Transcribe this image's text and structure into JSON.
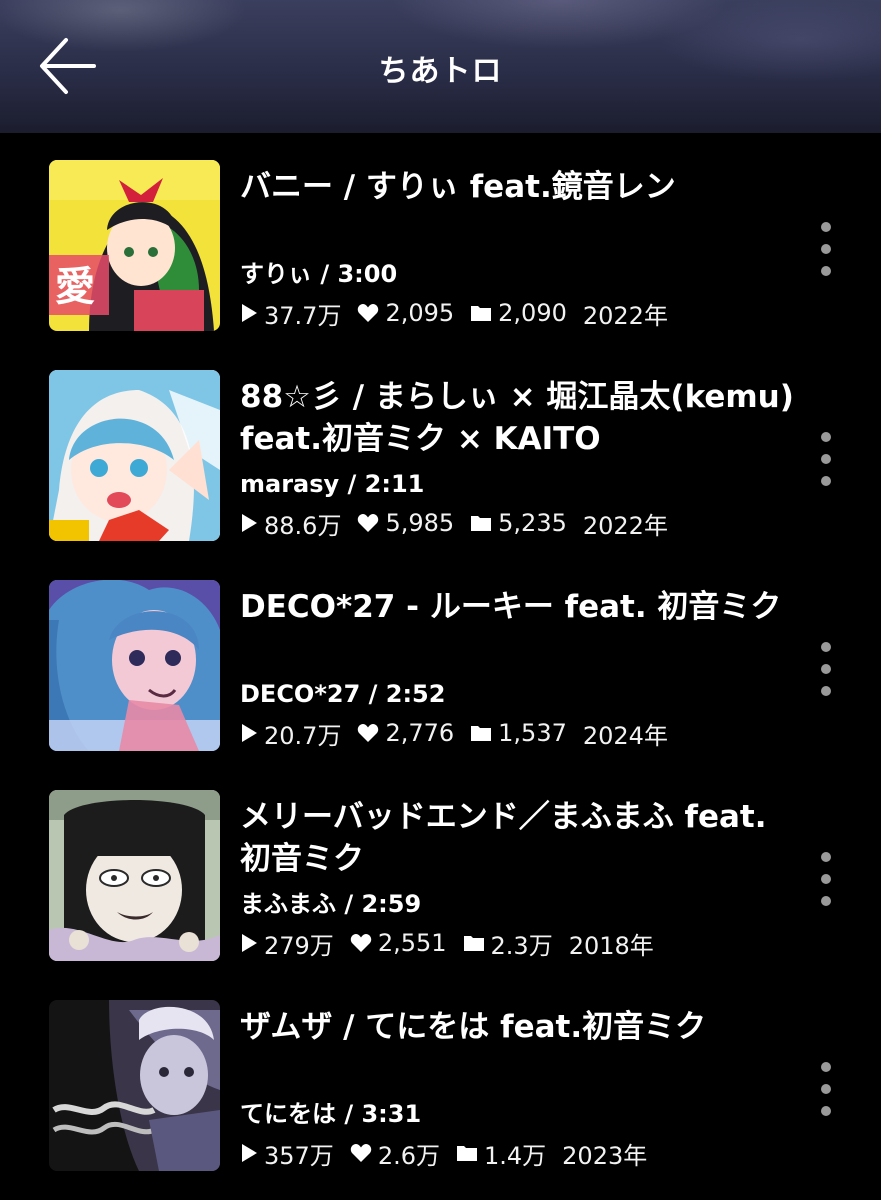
{
  "header": {
    "title": "ちあトロ",
    "back_icon": "back-arrow-icon"
  },
  "colors": {
    "background": "#000000",
    "text": "#ffffff",
    "menu_dots": "#9a9a9a"
  },
  "songs": [
    {
      "title": "バニー / すりぃ feat.鏡音レン",
      "artist_line": "すりぃ / 3:00",
      "plays": "37.7万",
      "likes": "2,095",
      "saves": "2,090",
      "year": "2022年"
    },
    {
      "title": "88☆彡 / まらしぃ × 堀江晶太(kemu) feat.初音ミク × KAITO",
      "artist_line": "marasy / 2:11",
      "plays": "88.6万",
      "likes": "5,985",
      "saves": "5,235",
      "year": "2022年"
    },
    {
      "title": "DECO*27 - ルーキー feat. 初音ミク",
      "artist_line": "DECO*27 / 2:52",
      "plays": "20.7万",
      "likes": "2,776",
      "saves": "1,537",
      "year": "2024年"
    },
    {
      "title": "メリーバッドエンド／まふまふ feat. 初音ミク",
      "artist_line": "まふまふ / 2:59",
      "plays": "279万",
      "likes": "2,551",
      "saves": "2.3万",
      "year": "2018年"
    },
    {
      "title": "ザムザ / てにをは feat.初音ミク",
      "artist_line": "てにをは / 3:31",
      "plays": "357万",
      "likes": "2.6万",
      "saves": "1.4万",
      "year": "2023年"
    }
  ]
}
